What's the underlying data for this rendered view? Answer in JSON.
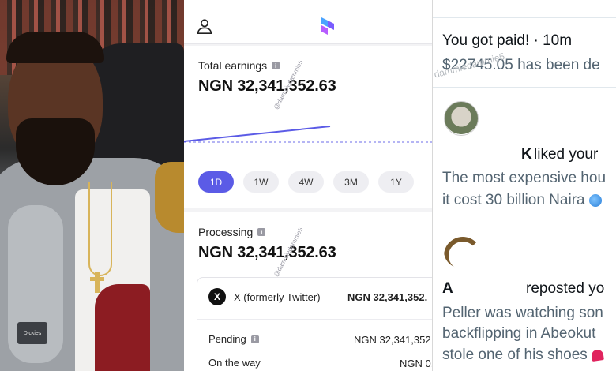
{
  "app": {
    "total_earnings_label": "Total earnings",
    "total_earnings_value": "NGN 32,341,352.63",
    "watermark": "@dammiedammie5",
    "ranges": [
      "1D",
      "1W",
      "4W",
      "3M",
      "1Y"
    ],
    "active_range": "1D",
    "processing_label": "Processing",
    "processing_value": "NGN 32,341,352.63",
    "platform_name": "X (formerly Twitter)",
    "platform_amount": "NGN 32,341,352.",
    "pending_label": "Pending",
    "pending_value": "NGN 32,341,352",
    "on_the_way_label": "On the way",
    "on_the_way_value": "NGN 0.",
    "accent_color": "#5b5be6"
  },
  "notifications": {
    "paid_title": "You got paid! · 10m",
    "paid_body": "$22745.05 has been de",
    "watermark": "dammiedammie5",
    "like_user_initial": "K",
    "like_action": " liked your ",
    "like_text_line1": "The most expensive hou",
    "like_text_line2": "it cost 30 billion Naira ",
    "repost_user_initial": "A",
    "repost_action": "reposted yo",
    "repost_text_line1": "Peller was watching son",
    "repost_text_line2": "backflipping in Abeokut",
    "repost_text_line3": "stole one of his shoes "
  },
  "photo": {
    "patch_text": "Dickies"
  }
}
